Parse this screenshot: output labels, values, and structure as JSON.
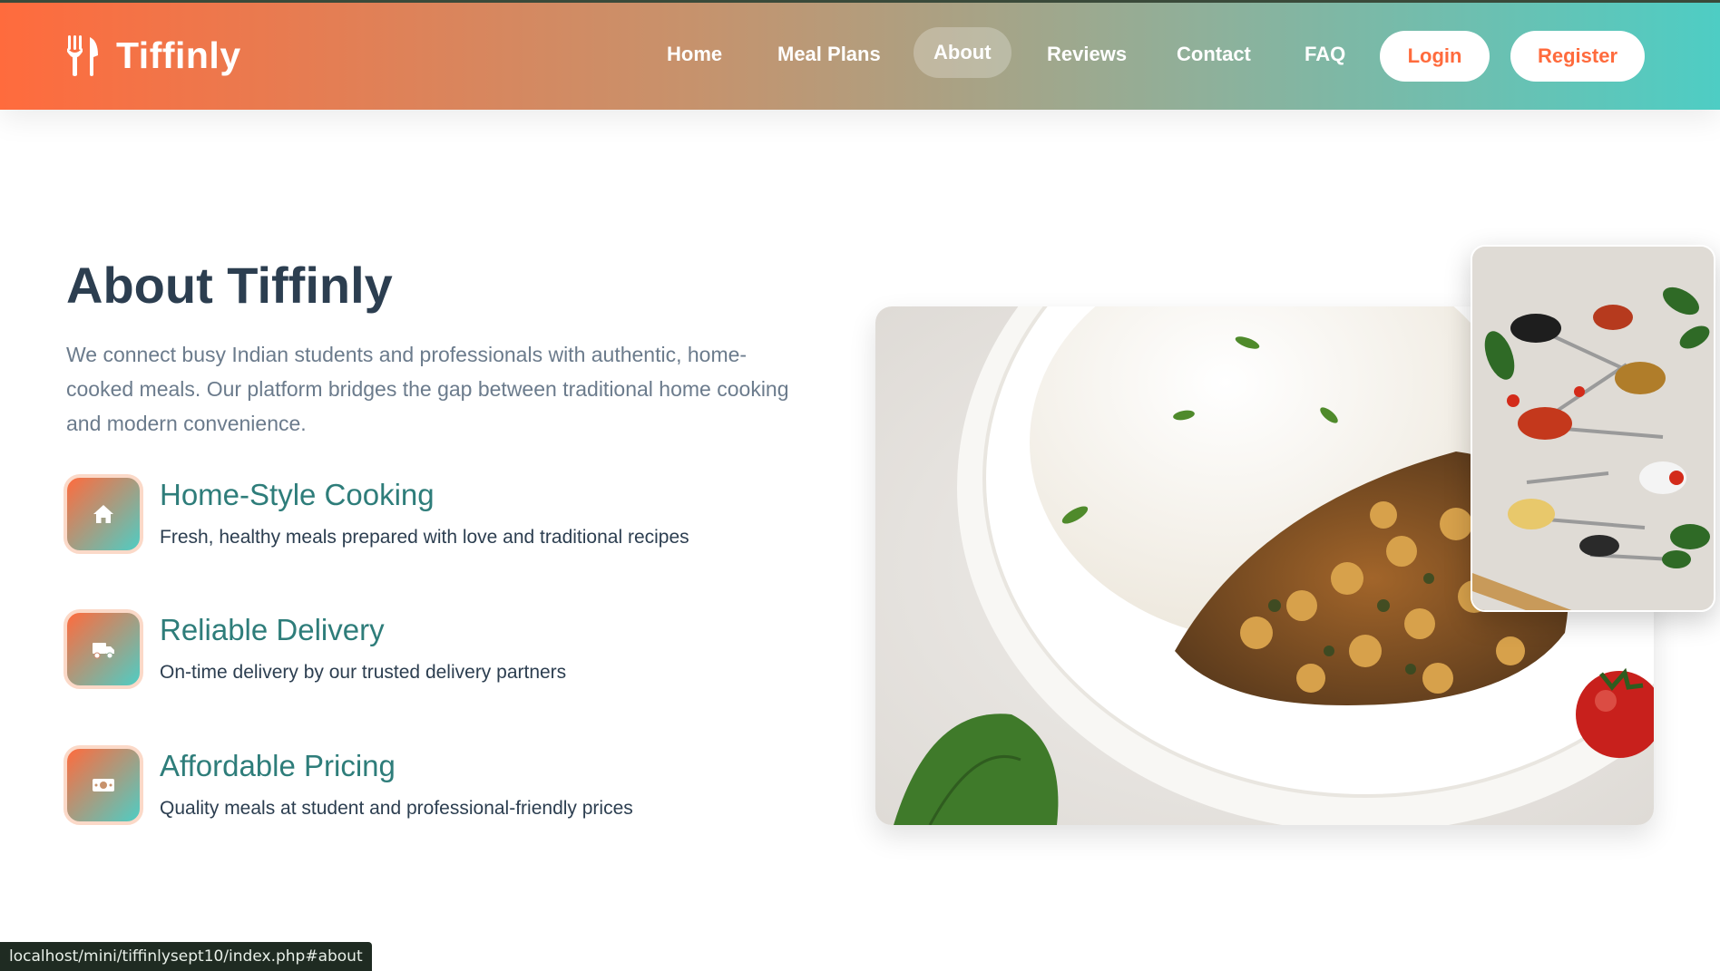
{
  "brand": {
    "name": "Tiffinly",
    "icon": "utensils-icon"
  },
  "nav": {
    "items": [
      {
        "label": "Home",
        "active": false
      },
      {
        "label": "Meal Plans",
        "active": false
      },
      {
        "label": "About",
        "active": true
      },
      {
        "label": "Reviews",
        "active": false
      },
      {
        "label": "Contact",
        "active": false
      },
      {
        "label": "FAQ",
        "active": false
      }
    ],
    "login_label": "Login",
    "register_label": "Register"
  },
  "about": {
    "title": "About Tiffinly",
    "description": "We connect busy Indian students and professionals with authentic, home-cooked meals. Our platform bridges the gap between traditional home cooking and modern convenience.",
    "features": [
      {
        "icon": "home-icon",
        "title": "Home-Style Cooking",
        "text": "Fresh, healthy meals prepared with love and traditional recipes"
      },
      {
        "icon": "truck-icon",
        "title": "Reliable Delivery",
        "text": "On-time delivery by our trusted delivery partners"
      },
      {
        "icon": "money-icon",
        "title": "Affordable Pricing",
        "text": "Quality meals at student and professional-friendly prices"
      }
    ]
  },
  "status_bar": {
    "url": "localhost/mini/tiffinlysept10/index.php#about"
  },
  "colors": {
    "accent_orange": "#ff6b3d",
    "accent_teal": "#4ecdc4",
    "heading": "#2c3e50",
    "feature_title": "#2e7d7a"
  }
}
